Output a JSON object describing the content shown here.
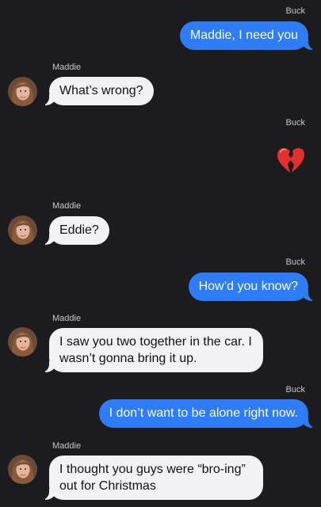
{
  "thread": {
    "messages": [
      {
        "from": "Buck",
        "direction": "outgoing",
        "text": "Maddie, I need you"
      },
      {
        "from": "Maddie",
        "direction": "incoming",
        "text": "What’s wrong?"
      },
      {
        "from": "Buck",
        "direction": "outgoing",
        "emoji": "broken-heart-icon"
      },
      {
        "from": "Maddie",
        "direction": "incoming",
        "text": "Eddie?"
      },
      {
        "from": "Buck",
        "direction": "outgoing",
        "text": "How’d you know?"
      },
      {
        "from": "Maddie",
        "direction": "incoming",
        "text": "I saw you two together in the car. I wasn’t gonna bring it up."
      },
      {
        "from": "Buck",
        "direction": "outgoing",
        "text": "I don’t want to be alone right now."
      },
      {
        "from": "Maddie",
        "direction": "incoming",
        "text": "I thought you guys were “bro-ing” out for Christmas"
      }
    ]
  },
  "colors": {
    "background": "#1c1c1e",
    "outgoing_bubble": "#2e7cf6",
    "incoming_bubble": "#f2f2f6",
    "sender_label": "#c7c7cc"
  }
}
